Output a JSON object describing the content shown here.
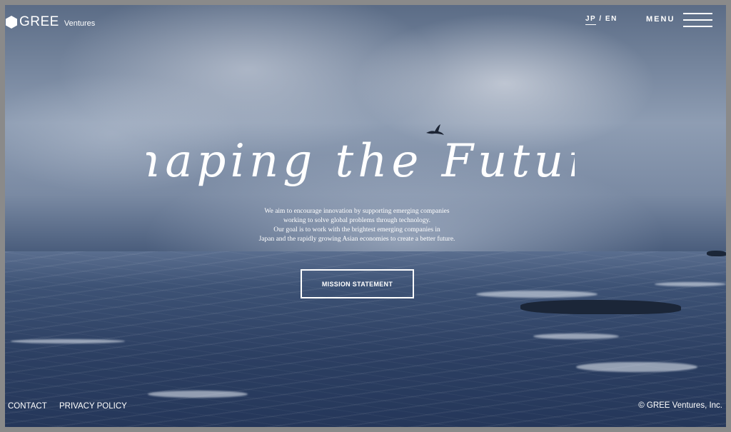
{
  "header": {
    "logo_text": "GREE",
    "logo_sub": "Ventures",
    "lang_jp": "JP",
    "lang_sep": "/",
    "lang_en": "EN",
    "menu_label": "MENU"
  },
  "hero": {
    "headline": "Shaping the Future",
    "intro_lines": [
      "We aim to encourage innovation by supporting emerging companies",
      "working to solve global problems through technology.",
      "Our goal is to work with the brightest emerging companies in",
      "Japan and the rapidly growing Asian economies to create a better future."
    ],
    "cta_label": "MISSION STATEMENT"
  },
  "footer": {
    "contact": "CONTACT",
    "privacy": "PRIVACY POLICY",
    "copyright": "© GREE Ventures, Inc."
  },
  "icons": [
    "hexagon-logo-icon",
    "hamburger-menu-icon"
  ],
  "colors": {
    "text": "#ffffff",
    "frame": "#8a8a8a",
    "sky": "#7a8aa3",
    "sea": "#2c3f62"
  }
}
